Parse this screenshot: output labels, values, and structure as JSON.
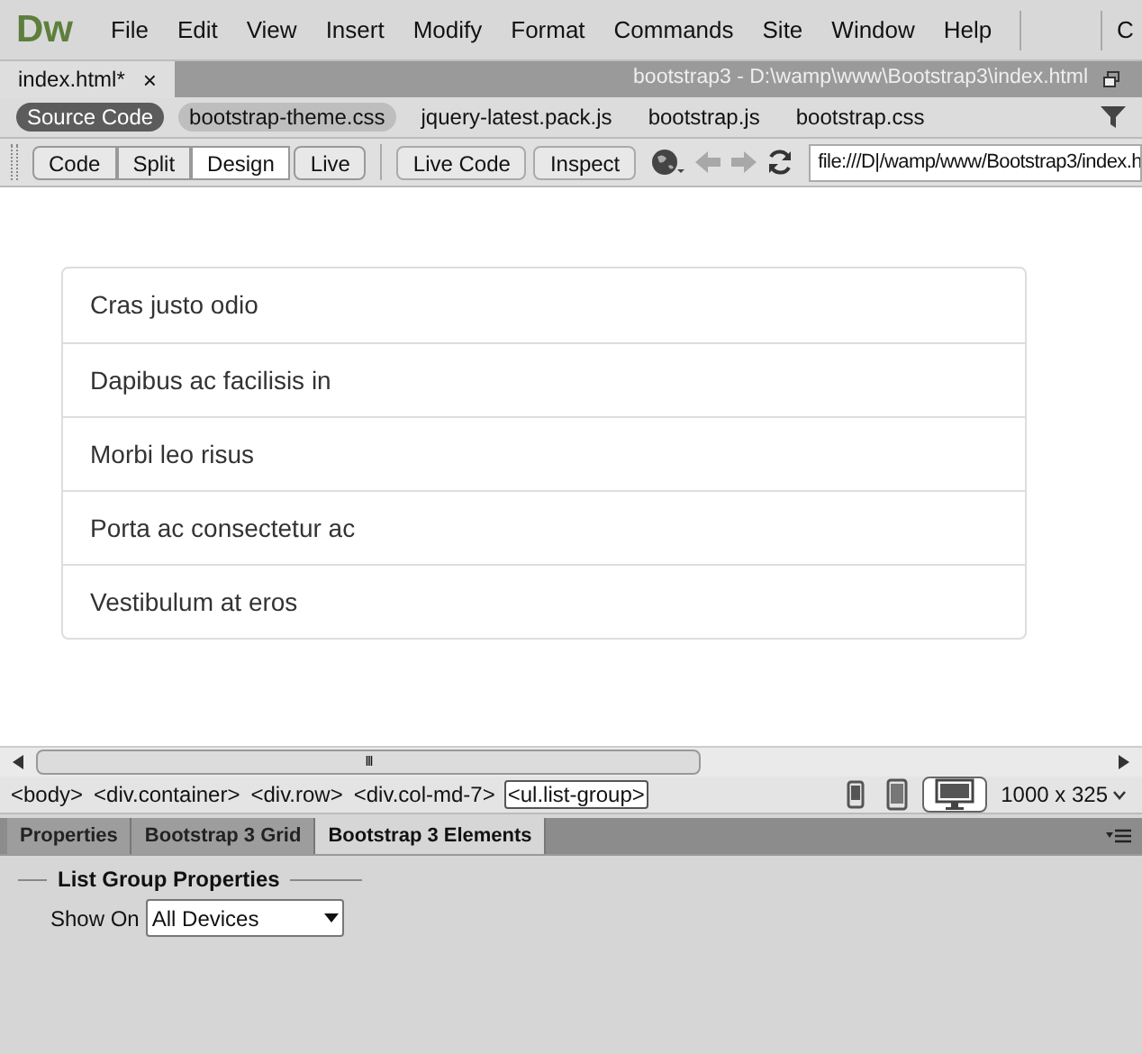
{
  "app": {
    "logo": "Dw",
    "menu": [
      "File",
      "Edit",
      "View",
      "Insert",
      "Modify",
      "Format",
      "Commands",
      "Site",
      "Window",
      "Help"
    ],
    "workspace": "C"
  },
  "document": {
    "tab": "index.html*",
    "close": "×",
    "path": "bootstrap3 - D:\\wamp\\www\\Bootstrap3\\index.html"
  },
  "related_files": [
    {
      "label": "Source Code",
      "selected": true
    },
    {
      "label": "bootstrap-theme.css",
      "selected": false
    },
    {
      "label": "jquery-latest.pack.js",
      "selected": false
    },
    {
      "label": "bootstrap.js",
      "selected": false
    },
    {
      "label": "bootstrap.css",
      "selected": false
    }
  ],
  "view_buttons": [
    {
      "label": "Code",
      "selected": false
    },
    {
      "label": "Split",
      "selected": false
    },
    {
      "label": "Design",
      "selected": true
    },
    {
      "label": "Live",
      "selected": false
    }
  ],
  "live_buttons": [
    "Live Code",
    "Inspect"
  ],
  "address": "file:///D|/wamp/www/Bootstrap3/index.h",
  "list_group": [
    "Cras justo odio",
    "Dapibus ac facilisis in",
    "Morbi leo risus",
    "Porta ac consectetur ac",
    "Vestibulum at eros"
  ],
  "scrollbar_grip": "III",
  "tag_selector": [
    {
      "label": "<body>",
      "selected": false
    },
    {
      "label": "<div.container>",
      "selected": false
    },
    {
      "label": "<div.row>",
      "selected": false
    },
    {
      "label": "<div.col-md-7>",
      "selected": false
    },
    {
      "label": "<ul.list-group>",
      "selected": true
    }
  ],
  "devices": [
    {
      "kind": "phone",
      "selected": false
    },
    {
      "kind": "tablet",
      "selected": false
    },
    {
      "kind": "desktop",
      "selected": true
    }
  ],
  "window_size": "1000 x 325",
  "panel_tabs": [
    {
      "label": "Properties",
      "selected": false
    },
    {
      "label": "Bootstrap 3 Grid",
      "selected": false
    },
    {
      "label": "Bootstrap 3 Elements",
      "selected": true
    }
  ],
  "panel": {
    "heading": "List Group Properties",
    "show_on_label": "Show On",
    "show_on_value": "All Devices"
  }
}
